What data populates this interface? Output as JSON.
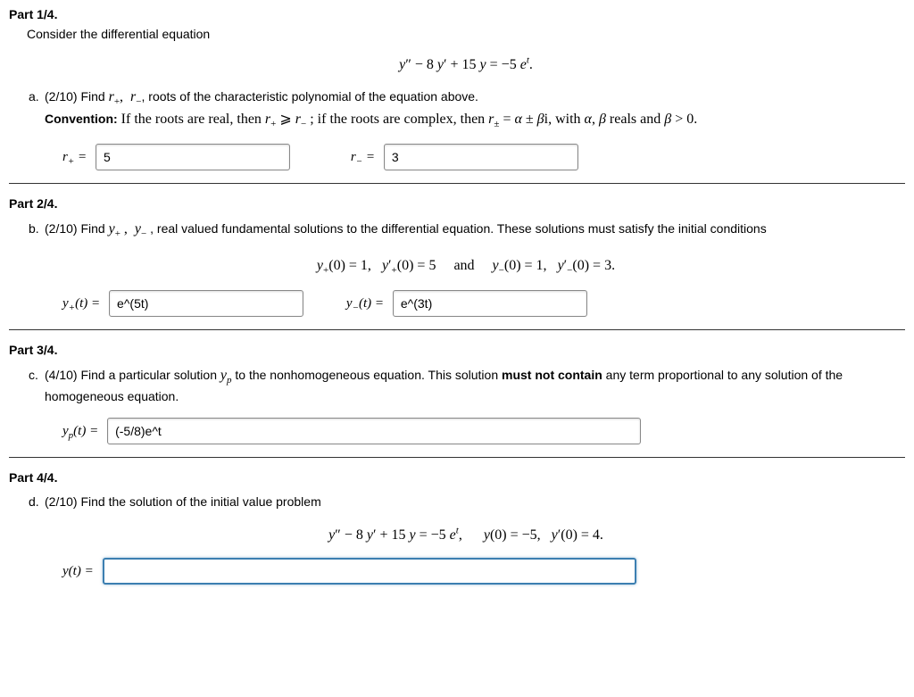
{
  "part1": {
    "header": "Part 1/4.",
    "intro": "Consider the differential equation",
    "equation": "y″ − 8 y′ + 15 y = −5 eᵗ.",
    "a_text1": "(2/10) Find ",
    "a_text2": ", roots of the characteristic polynomial of the equation above.",
    "convention_label": "Convention:",
    "convention_text": " If the roots are real, then r₊ ⩾ r₋ ; if the roots are complex, then r± = α ± βi, with α, β reals and β > 0.",
    "rplus_label": "r₊ =",
    "rplus_value": "5",
    "rminus_label": "r₋ =",
    "rminus_value": "3"
  },
  "part2": {
    "header": "Part 2/4.",
    "b_text": "(2/10) Find y₊ , y₋ , real valued fundamental solutions to the differential equation. These solutions must satisfy the initial conditions",
    "ic_equation": "y₊(0) = 1, y′₊(0) = 5  and  y₋(0) = 1, y′₋(0) = 3.",
    "yplus_label": "y₊(t) =",
    "yplus_value": "e^(5t)",
    "yminus_label": "y₋(t) =",
    "yminus_value": "e^(3t)"
  },
  "part3": {
    "header": "Part 3/4.",
    "c_text": "(4/10) Find a particular solution yₚ to the nonhomogeneous equation. This solution ",
    "c_bold": "must not contain",
    "c_text2": " any term proportional to any solution of the homogeneous equation.",
    "yp_label": "yₚ(t) =",
    "yp_value": "(-5/8)e^t"
  },
  "part4": {
    "header": "Part 4/4.",
    "d_text": "(2/10) Find the solution of the initial value problem",
    "ivp_equation": "y″ − 8 y′ + 15 y = −5 eᵗ,  y(0) = −5, y′(0) = 4.",
    "y_label": "y(t) =",
    "y_value": ""
  }
}
